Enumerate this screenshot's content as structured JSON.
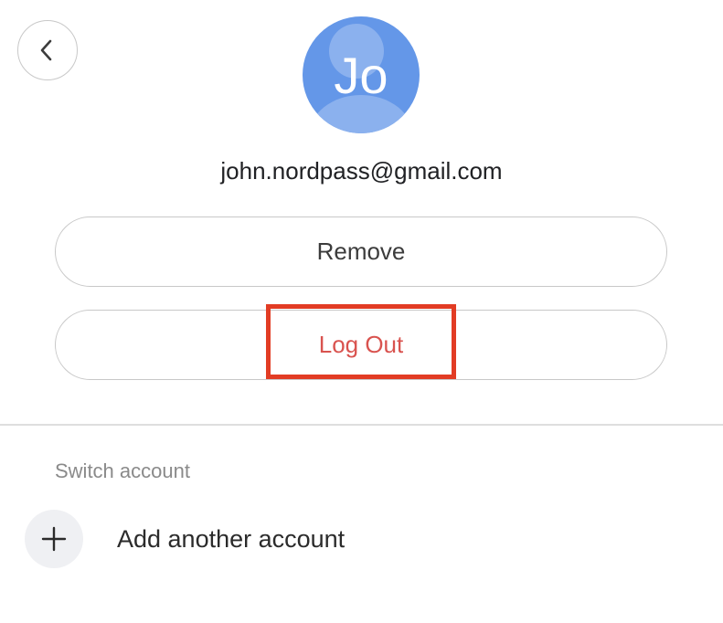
{
  "header": {
    "back_icon": "chevron-left-icon"
  },
  "profile": {
    "avatar_initials": "Jo",
    "avatar_color": "#6497e8",
    "email": "john.nordpass@gmail.com"
  },
  "actions": {
    "remove_label": "Remove",
    "logout_label": "Log Out",
    "logout_color": "#d9534f",
    "highlight_color": "#e23c24"
  },
  "switch_account": {
    "section_label": "Switch account",
    "add_icon": "plus-icon",
    "add_label": "Add another account"
  }
}
